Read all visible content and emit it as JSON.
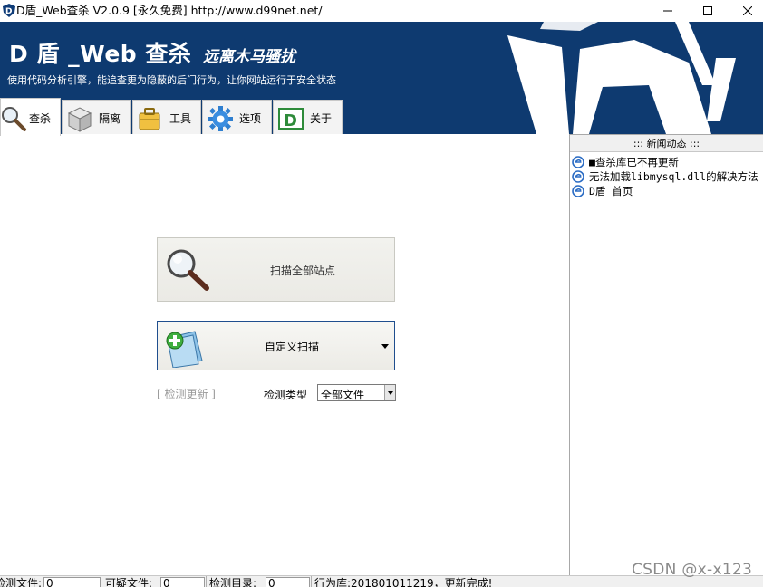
{
  "window": {
    "title": "D盾_Web查杀 V2.0.9 [永久免费] http://www.d99net.net/"
  },
  "banner": {
    "title": "D 盾 _Web 查杀",
    "slogan": "远离木马骚扰",
    "description": "使用代码分析引擎，能追查更为隐蔽的后门行为，让你网站运行于安全状态"
  },
  "tabs": [
    {
      "label": "查杀",
      "icon": "magnifier-icon",
      "active": true
    },
    {
      "label": "隔离",
      "icon": "box-icon",
      "active": false
    },
    {
      "label": "工具",
      "icon": "toolbox-icon",
      "active": false
    },
    {
      "label": "选项",
      "icon": "gear-icon",
      "active": false
    },
    {
      "label": "关于",
      "icon": "d-logo-icon",
      "active": false
    }
  ],
  "main": {
    "scan_all_label": "扫描全部站点",
    "custom_scan_label": "自定义扫描",
    "check_update": "[ 检测更新 ]",
    "detect_type_label": "检测类型",
    "detect_type_value": "全部文件"
  },
  "news": {
    "header": "::: 新闻动态 :::",
    "items": [
      "■查杀库已不再更新",
      "无法加载libmysql.dll的解决方法",
      "D盾_首页"
    ]
  },
  "status": {
    "detected_files_label": "检测文件:",
    "detected_files_value": "0",
    "suspicious_files_label": "可疑文件:",
    "suspicious_files_value": "0",
    "detected_dirs_label": "检测目录:",
    "detected_dirs_value": "0",
    "behavior_db": "行为库:201801011219，更新完成!"
  },
  "watermark": "CSDN @x-x123",
  "colors": {
    "banner_bg": "#0e3a70",
    "button_border": "#1f4e8e"
  }
}
